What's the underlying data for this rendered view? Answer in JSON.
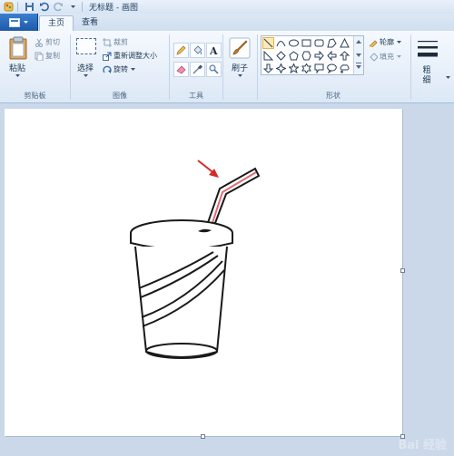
{
  "window": {
    "title": "无标题 - 画图"
  },
  "tabs": {
    "file_icon": "paint-menu-icon",
    "home": "主页",
    "view": "查看"
  },
  "clipboard": {
    "paste": "粘贴",
    "cut": "剪切",
    "copy": "复制",
    "group": "剪贴板"
  },
  "image": {
    "select": "选择",
    "crop": "裁剪",
    "resize": "重新调整大小",
    "rotate": "旋转",
    "group": "图像"
  },
  "tools": {
    "group": "工具",
    "items": [
      "pencil-icon",
      "fill-icon",
      "text-icon",
      "eraser-icon",
      "color-picker-icon",
      "magnifier-icon"
    ]
  },
  "brushes": {
    "label": "刷子"
  },
  "shapes": {
    "outline": "轮廓",
    "fill": "填充",
    "group": "形状"
  },
  "size": {
    "label1": "粗",
    "label2": "细"
  },
  "colors": {
    "accent": "#1d5aa8",
    "straw": "#e06a73",
    "arrow": "#d42a2a"
  },
  "watermark": "Bai 经验"
}
